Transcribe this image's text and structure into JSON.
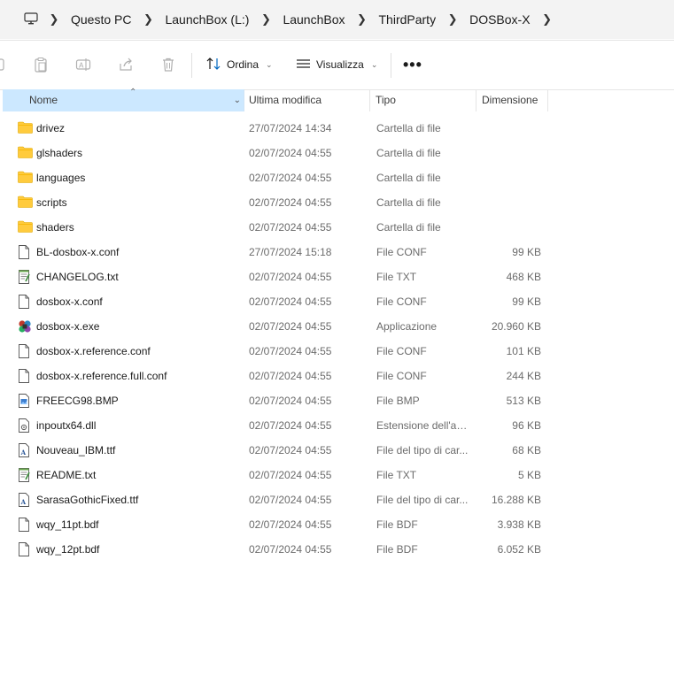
{
  "breadcrumb": {
    "items": [
      "Questo PC",
      "LaunchBox (L:)",
      "LaunchBox",
      "ThirdParty",
      "DOSBox-X"
    ]
  },
  "toolbar": {
    "sort_label": "Ordina",
    "view_label": "Visualizza",
    "more_label": "•••"
  },
  "columns": {
    "name": "Nome",
    "modified": "Ultima modifica",
    "type": "Tipo",
    "size": "Dimensione"
  },
  "files": [
    {
      "icon": "folder-icon",
      "name": "drivez",
      "modified": "27/07/2024 14:34",
      "type": "Cartella di file",
      "size": ""
    },
    {
      "icon": "folder-icon",
      "name": "glshaders",
      "modified": "02/07/2024 04:55",
      "type": "Cartella di file",
      "size": ""
    },
    {
      "icon": "folder-icon",
      "name": "languages",
      "modified": "02/07/2024 04:55",
      "type": "Cartella di file",
      "size": ""
    },
    {
      "icon": "folder-icon",
      "name": "scripts",
      "modified": "02/07/2024 04:55",
      "type": "Cartella di file",
      "size": ""
    },
    {
      "icon": "folder-icon",
      "name": "shaders",
      "modified": "02/07/2024 04:55",
      "type": "Cartella di file",
      "size": ""
    },
    {
      "icon": "file-icon",
      "name": "BL-dosbox-x.conf",
      "modified": "27/07/2024 15:18",
      "type": "File CONF",
      "size": "99 KB"
    },
    {
      "icon": "text-file-icon",
      "name": "CHANGELOG.txt",
      "modified": "02/07/2024 04:55",
      "type": "File TXT",
      "size": "468 KB"
    },
    {
      "icon": "file-icon",
      "name": "dosbox-x.conf",
      "modified": "02/07/2024 04:55",
      "type": "File CONF",
      "size": "99 KB"
    },
    {
      "icon": "exe-icon",
      "name": "dosbox-x.exe",
      "modified": "02/07/2024 04:55",
      "type": "Applicazione",
      "size": "20.960 KB"
    },
    {
      "icon": "file-icon",
      "name": "dosbox-x.reference.conf",
      "modified": "02/07/2024 04:55",
      "type": "File CONF",
      "size": "101 KB"
    },
    {
      "icon": "file-icon",
      "name": "dosbox-x.reference.full.conf",
      "modified": "02/07/2024 04:55",
      "type": "File CONF",
      "size": "244 KB"
    },
    {
      "icon": "image-file-icon",
      "name": "FREECG98.BMP",
      "modified": "02/07/2024 04:55",
      "type": "File BMP",
      "size": "513 KB"
    },
    {
      "icon": "dll-file-icon",
      "name": "inpoutx64.dll",
      "modified": "02/07/2024 04:55",
      "type": "Estensione dell'ap...",
      "size": "96 KB"
    },
    {
      "icon": "font-file-icon",
      "name": "Nouveau_IBM.ttf",
      "modified": "02/07/2024 04:55",
      "type": "File del tipo di car...",
      "size": "68 KB"
    },
    {
      "icon": "text-file-icon",
      "name": "README.txt",
      "modified": "02/07/2024 04:55",
      "type": "File TXT",
      "size": "5 KB"
    },
    {
      "icon": "font-file-icon",
      "name": "SarasaGothicFixed.ttf",
      "modified": "02/07/2024 04:55",
      "type": "File del tipo di car...",
      "size": "16.288 KB"
    },
    {
      "icon": "file-icon",
      "name": "wqy_11pt.bdf",
      "modified": "02/07/2024 04:55",
      "type": "File BDF",
      "size": "3.938 KB"
    },
    {
      "icon": "file-icon",
      "name": "wqy_12pt.bdf",
      "modified": "02/07/2024 04:55",
      "type": "File BDF",
      "size": "6.052 KB"
    }
  ],
  "colors": {
    "header_selected": "#cce8ff",
    "folder": "#ffcb3d",
    "accent": "#0067c0"
  }
}
